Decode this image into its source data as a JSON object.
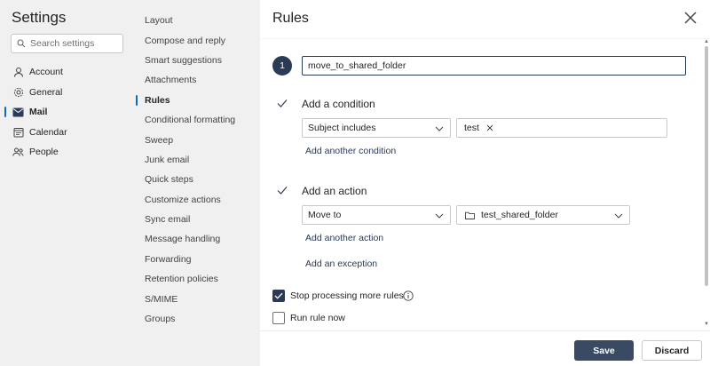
{
  "settings": {
    "title": "Settings",
    "search_placeholder": "Search settings"
  },
  "nav": [
    {
      "label": "Account",
      "icon": "person-icon"
    },
    {
      "label": "General",
      "icon": "gear-icon"
    },
    {
      "label": "Mail",
      "icon": "mail-icon",
      "active": true
    },
    {
      "label": "Calendar",
      "icon": "calendar-icon"
    },
    {
      "label": "People",
      "icon": "people-icon"
    }
  ],
  "mail_sections": [
    {
      "label": "Layout"
    },
    {
      "label": "Compose and reply"
    },
    {
      "label": "Smart suggestions"
    },
    {
      "label": "Attachments"
    },
    {
      "label": "Rules",
      "active": true
    },
    {
      "label": "Conditional formatting"
    },
    {
      "label": "Sweep"
    },
    {
      "label": "Junk email"
    },
    {
      "label": "Quick steps"
    },
    {
      "label": "Customize actions"
    },
    {
      "label": "Sync email"
    },
    {
      "label": "Message handling"
    },
    {
      "label": "Forwarding"
    },
    {
      "label": "Retention policies"
    },
    {
      "label": "S/MIME"
    },
    {
      "label": "Groups"
    }
  ],
  "rules": {
    "title": "Rules",
    "step_number": "1",
    "rule_name": "move_to_shared_folder",
    "condition": {
      "label": "Add a condition",
      "field": "Subject includes",
      "tags": [
        "test"
      ],
      "add_link": "Add another condition"
    },
    "action": {
      "label": "Add an action",
      "field": "Move to",
      "folder": "test_shared_folder",
      "add_link": "Add another action"
    },
    "exception_link": "Add an exception",
    "stop_processing": {
      "label": "Stop processing more rules",
      "checked": true
    },
    "run_now": {
      "label": "Run rule now",
      "checked": false
    },
    "save_label": "Save",
    "discard_label": "Discard"
  },
  "colors": {
    "accent": "#2b3a55",
    "nav_indicator": "#0f6cbd"
  }
}
